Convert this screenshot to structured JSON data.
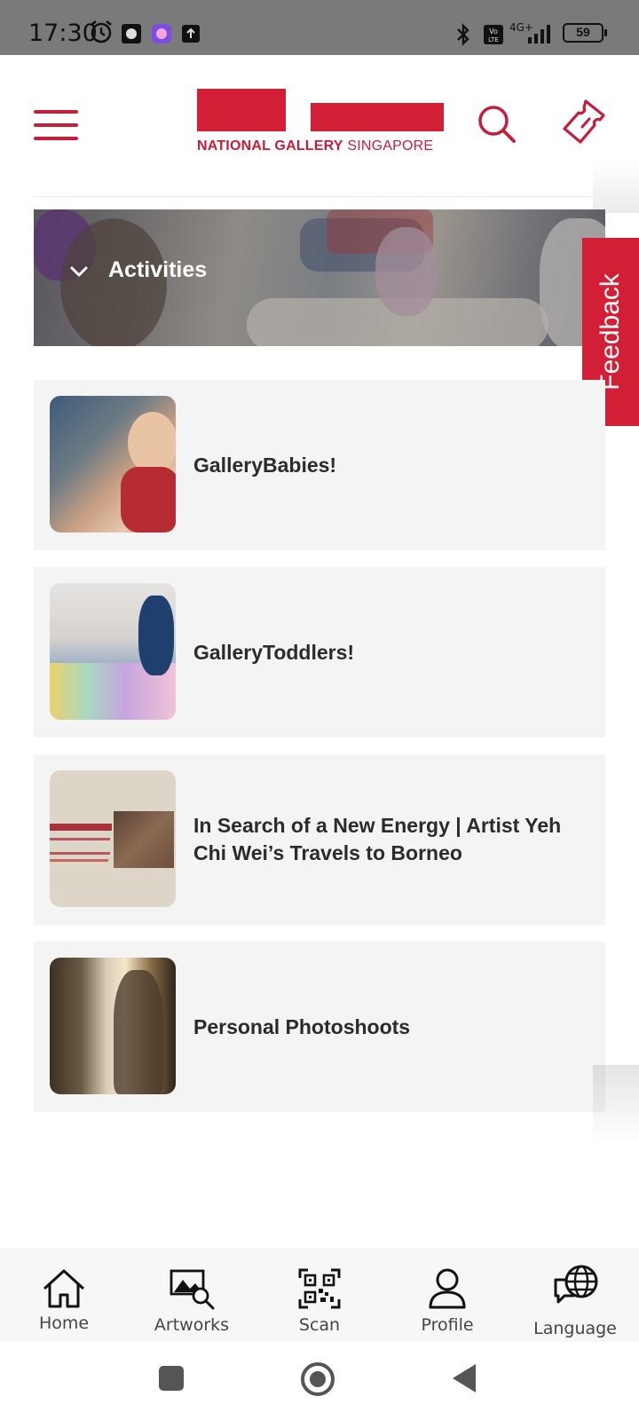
{
  "status_bar": {
    "time": "17:30",
    "battery": "59",
    "network": "4G+",
    "volte": "Vo LTE"
  },
  "header": {
    "logo_bold": "NATIONAL GALLERY",
    "logo_light": " SINGAPORE",
    "brand_color": "#d31f36"
  },
  "banner": {
    "title": "Activities"
  },
  "feedback": {
    "label": "Feedback"
  },
  "cards": [
    {
      "title": "GalleryBabies!",
      "thumb_icon": "babies-photo"
    },
    {
      "title": "GalleryToddlers!",
      "thumb_icon": "toddlers-photo"
    },
    {
      "title": "In Search of a New Energy | Artist Yeh Chi Wei’s Travels to Borneo",
      "thumb_icon": "exhibition-poster"
    },
    {
      "title": "Personal Photoshoots",
      "thumb_icon": "photoshoot-photo"
    }
  ],
  "bottom_nav": [
    {
      "label": "Home",
      "icon": "home-icon"
    },
    {
      "label": "Artworks",
      "icon": "artworks-icon"
    },
    {
      "label": "Scan",
      "icon": "qr-scan-icon"
    },
    {
      "label": "Profile",
      "icon": "profile-icon"
    },
    {
      "label": "Language",
      "icon": "language-icon"
    }
  ],
  "colors": {
    "accent": "#d31f36",
    "card_bg": "#f4f4f4",
    "status_bar_bg": "#7a7a7a"
  }
}
